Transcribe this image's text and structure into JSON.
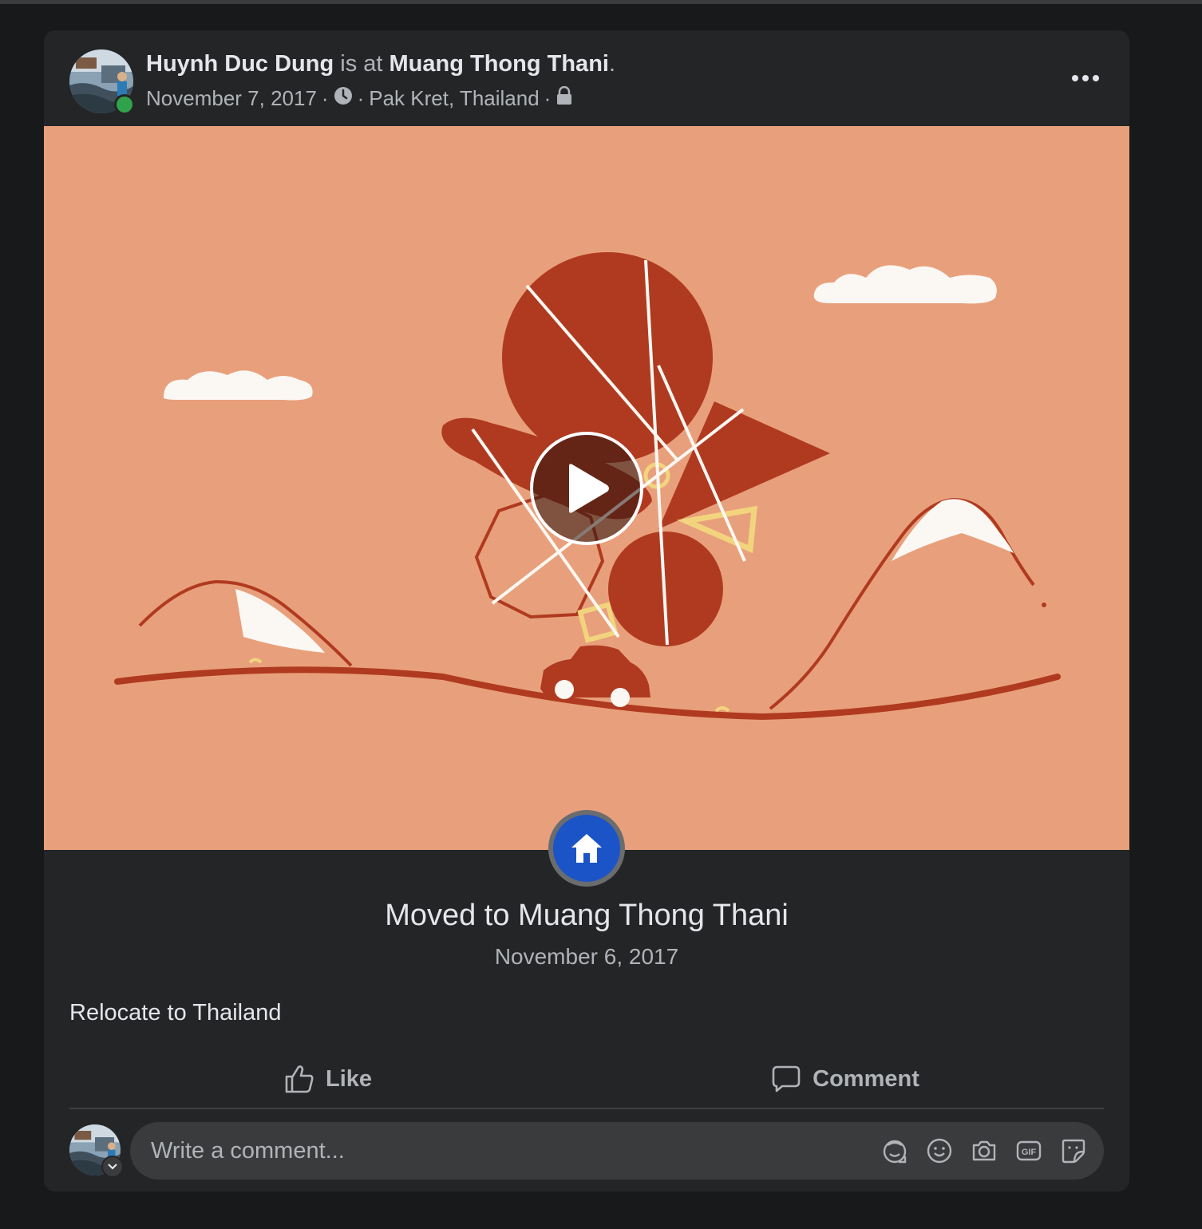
{
  "post": {
    "author": "Huynh Duc Dung",
    "connector": " is at ",
    "place": "Muang Thong Thani",
    "end_punct": ".",
    "date": "November 7, 2017",
    "location": "Pak Kret, Thailand",
    "sep": "·",
    "privacy_icon": "lock-icon",
    "more_icon": "more-options-icon"
  },
  "life_event": {
    "badge_icon": "home-icon",
    "title": "Moved to Muang Thong Thani",
    "date": "November 6, 2017"
  },
  "caption": "Relocate to Thailand",
  "actions": {
    "like_label": "Like",
    "comment_label": "Comment"
  },
  "comment": {
    "placeholder": "Write a comment...",
    "tools": [
      "avatar-sticker-icon",
      "emoji-icon",
      "camera-icon",
      "gif-icon",
      "sticker-icon"
    ]
  },
  "colors": {
    "background": "#18191a",
    "card": "#242526",
    "media_bg": "#e8a07c",
    "accent_red": "#b03a20",
    "badge_blue": "#1b54c7",
    "online_green": "#31a24c"
  }
}
